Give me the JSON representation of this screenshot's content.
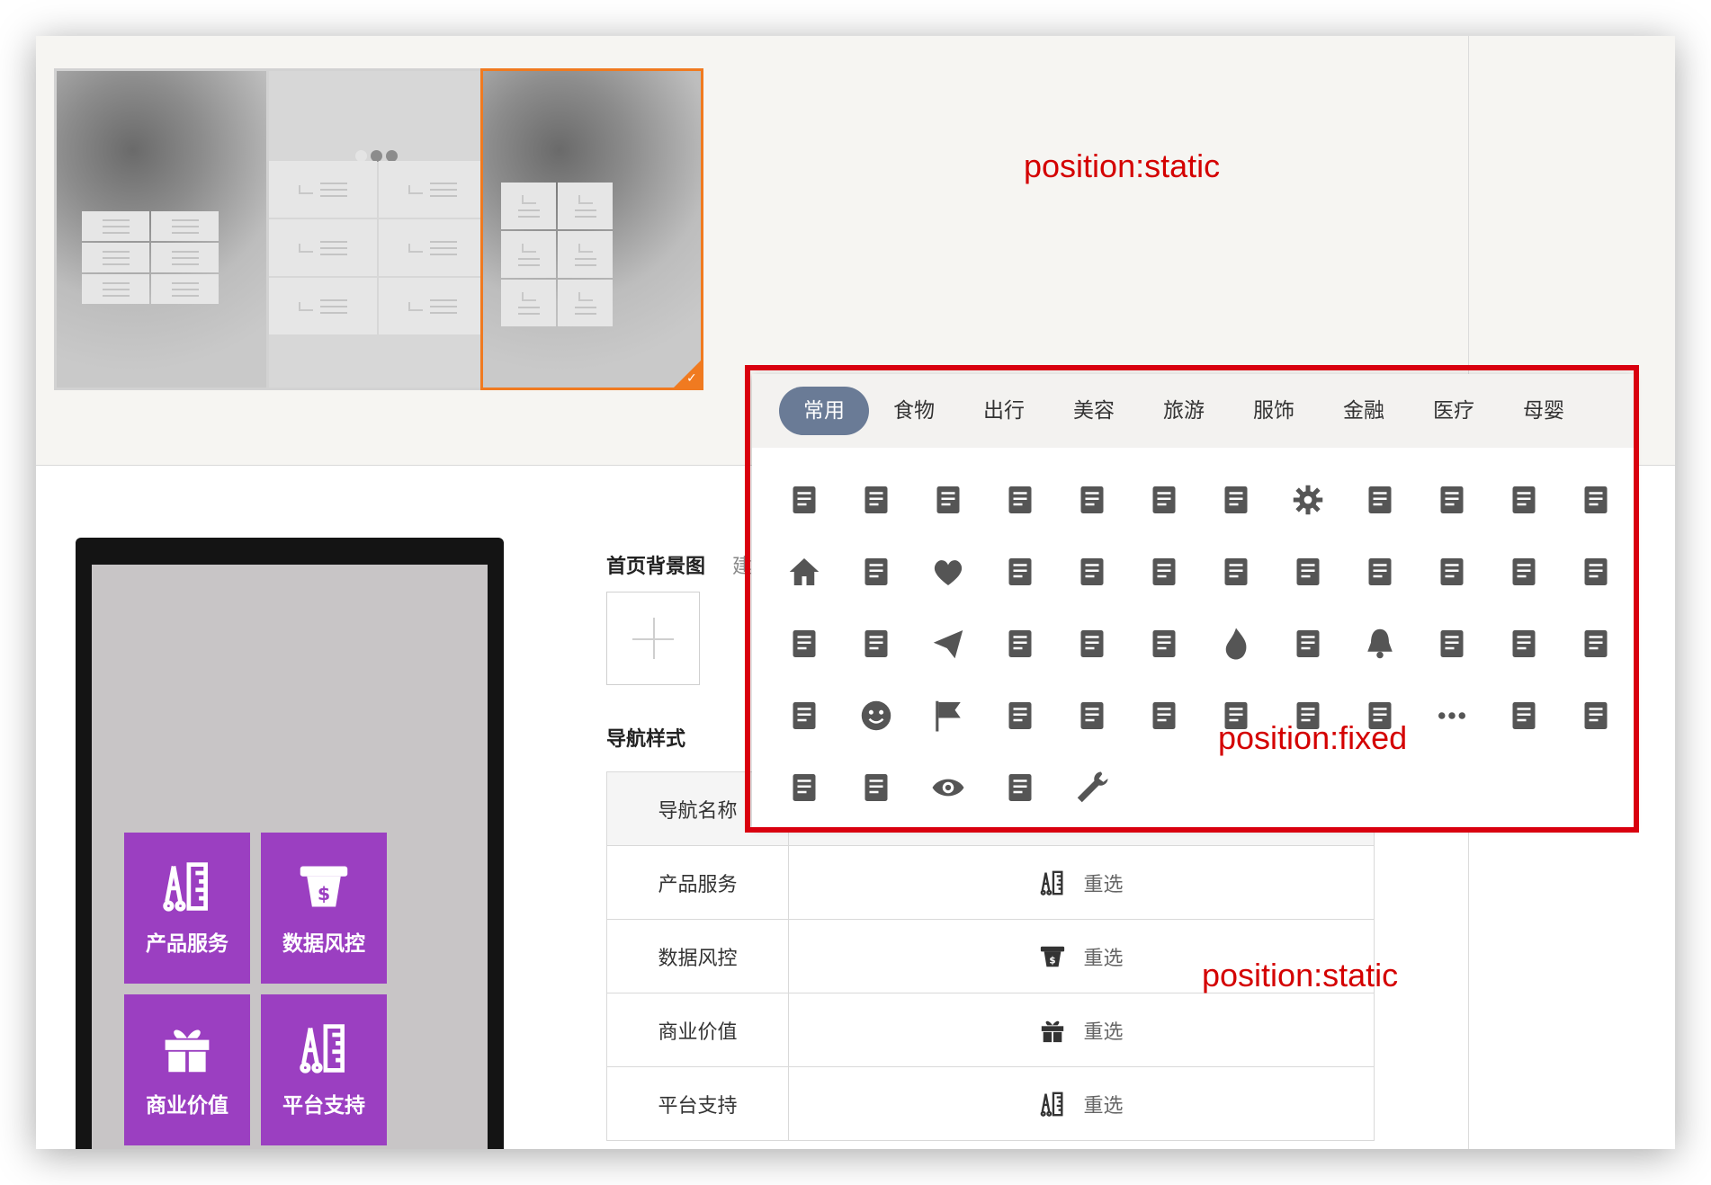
{
  "annotations": {
    "static_top": "position:static",
    "fixed": "position:fixed",
    "static_bottom": "position:static"
  },
  "form": {
    "background_label": "首页背景图",
    "background_hint": "建议尺",
    "nav_style_label": "导航样式"
  },
  "table": {
    "header_name": "导航名称",
    "rows": [
      {
        "name": "产品服务",
        "icon": "ruler-icon",
        "action": "重选"
      },
      {
        "name": "数据风控",
        "icon": "cash-register-icon",
        "action": "重选"
      },
      {
        "name": "商业价值",
        "icon": "gift-icon",
        "action": "重选"
      },
      {
        "name": "平台支持",
        "icon": "ruler-icon",
        "action": "重选"
      }
    ]
  },
  "preview_tiles": [
    "产品服务",
    "数据风控",
    "商业价值",
    "平台支持"
  ],
  "icon_picker": {
    "tabs": [
      "常用",
      "食物",
      "出行",
      "美容",
      "旅游",
      "服饰",
      "金融",
      "医疗",
      "母婴"
    ],
    "active_tab": "常用",
    "icons": [
      "newspaper-icon",
      "archive-icon",
      "trophy-icon",
      "book-icon",
      "open-book-icon",
      "bookmark-star-icon",
      "lightbulb-icon",
      "gear-icon",
      "document-icon",
      "document-lines-icon",
      "stamp-icon",
      "gift-icon",
      "home-icon",
      "thumbs-up-sparkle-icon",
      "heart-icon",
      "mailbox-icon",
      "video-camera-icon",
      "news-icon",
      "notepad-icon",
      "file-person-icon",
      "lamp-icon",
      "presentation-image-icon",
      "presentation-chart-icon",
      "presentation-play-icon",
      "podium-icon",
      "fast-mail-icon",
      "paper-plane-icon",
      "box-icon",
      "store-icon",
      "toolbox-icon",
      "fire-icon",
      "warning-star-icon",
      "bell-icon",
      "medal-icon",
      "badge-check-icon",
      "chat-bubbles-icon",
      "drone-icon",
      "smiley-icon",
      "flag-icon",
      "heart-hands-icon",
      "lifebuoy-icon",
      "sitemap-icon",
      "megaphone-icon",
      "person-speech-icon",
      "chat-smile-icon",
      "ellipsis-icon",
      "feather-icon",
      "podium-icon",
      "smartwatch-icon",
      "briefcase-icon",
      "eye-icon",
      "webcam-icon",
      "wrench-icon"
    ]
  },
  "colors": {
    "accent_orange": "#f07a20",
    "tile_purple": "#9b3fc1",
    "tab_active": "#6a7b96",
    "annotation_red": "#d40000"
  }
}
